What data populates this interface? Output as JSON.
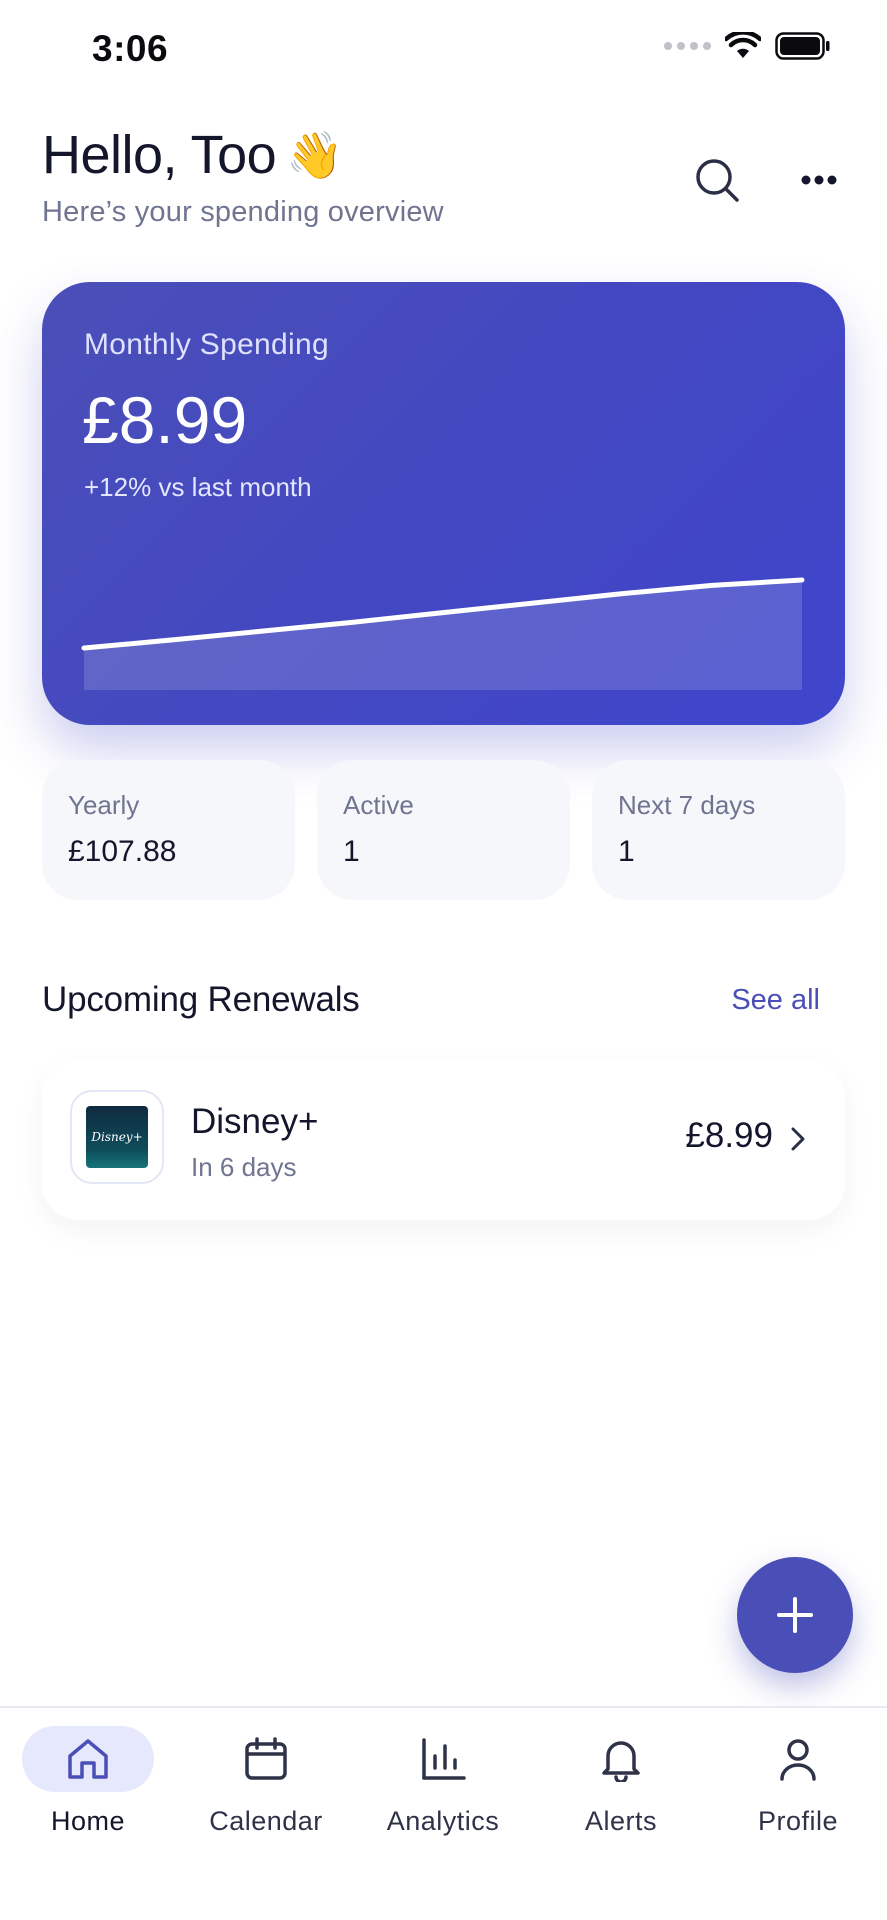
{
  "status_bar": {
    "time": "3:06"
  },
  "header": {
    "greeting": "Hello, Too",
    "wave_emoji": "👋",
    "subtitle": "Here’s your spending overview",
    "search_icon": "search-icon",
    "more_icon": "more-horizontal-icon"
  },
  "spending_card": {
    "label": "Monthly Spending",
    "amount": "£8.99",
    "change": "+12% vs last month",
    "trend_values": [
      0.0,
      0.12,
      0.25,
      0.38,
      0.52,
      0.66,
      0.8,
      0.92,
      1.0
    ],
    "colors": {
      "card": "#4347c2",
      "line": "#ffffff"
    }
  },
  "stats": [
    {
      "label": "Yearly",
      "value": "£107.88"
    },
    {
      "label": "Active",
      "value": "1"
    },
    {
      "label": "Next 7 days",
      "value": "1"
    }
  ],
  "renewals": {
    "title": "Upcoming Renewals",
    "see_all": "See all",
    "items": [
      {
        "name": "Disney+",
        "when": "In 6 days",
        "price": "£8.99",
        "logo_text": "Disney+"
      }
    ]
  },
  "fab": {
    "icon": "plus-icon"
  },
  "tab_bar": {
    "tabs": [
      {
        "label": "Home",
        "icon": "home-icon",
        "active": true
      },
      {
        "label": "Calendar",
        "icon": "calendar-icon",
        "active": false
      },
      {
        "label": "Analytics",
        "icon": "bar-chart-icon",
        "active": false
      },
      {
        "label": "Alerts",
        "icon": "bell-icon",
        "active": false
      },
      {
        "label": "Profile",
        "icon": "user-icon",
        "active": false
      }
    ]
  },
  "colors": {
    "accent": "#4a4fb8",
    "text": "#14162b",
    "muted": "#6f7590"
  }
}
